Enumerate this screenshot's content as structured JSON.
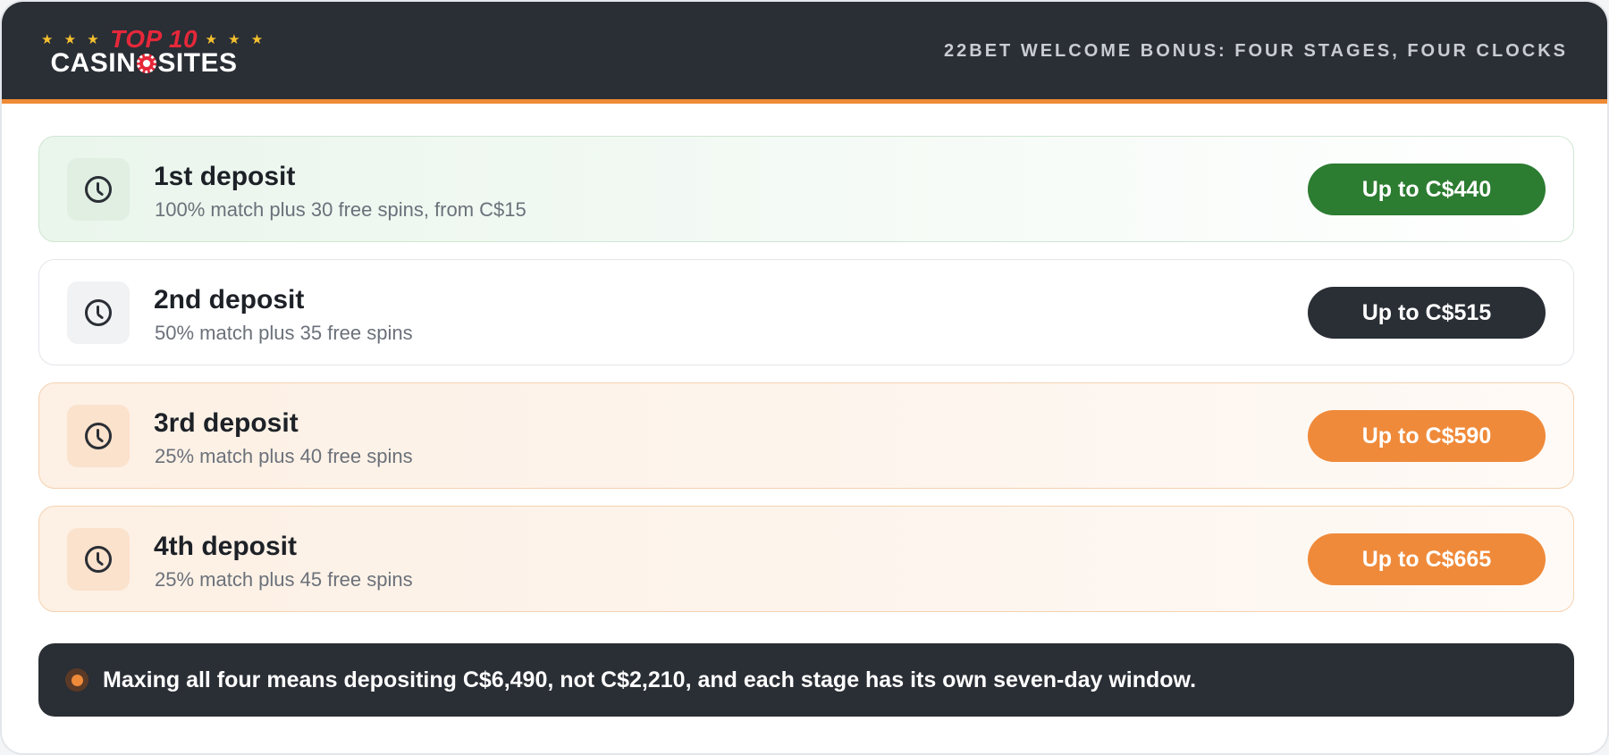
{
  "brand": {
    "logo_top": "TOP 10",
    "logo_stars_left": "★ ★ ★",
    "logo_stars_right": "★ ★ ★",
    "logo_bottom_left": "CASIN",
    "logo_bottom_right": "SITES"
  },
  "header": {
    "title": "22BET WELCOME BONUS: FOUR STAGES, FOUR CLOCKS"
  },
  "deposits": [
    {
      "title": "1st deposit",
      "description": "100% match plus 30 free spins, from C$15",
      "amount": "Up to C$440",
      "icon": "clock-icon",
      "theme": "green"
    },
    {
      "title": "2nd deposit",
      "description": "50% match plus 35 free spins",
      "amount": "Up to C$515",
      "icon": "clock-icon",
      "theme": "neutral"
    },
    {
      "title": "3rd deposit",
      "description": "25% match plus 40 free spins",
      "amount": "Up to C$590",
      "icon": "clock-icon",
      "theme": "orange"
    },
    {
      "title": "4th deposit",
      "description": "25% match plus 45 free spins",
      "amount": "Up to C$665",
      "icon": "clock-icon",
      "theme": "orange"
    }
  ],
  "footer": {
    "note": "Maxing all four means depositing C$6,490, not C$2,210, and each stage has its own seven-day window."
  },
  "colors": {
    "header_bg": "#2a2e35",
    "accent_orange": "#ef8a3a",
    "accent_green": "#2c7c31",
    "logo_red": "#e5283a",
    "star_yellow": "#f5c12e"
  }
}
